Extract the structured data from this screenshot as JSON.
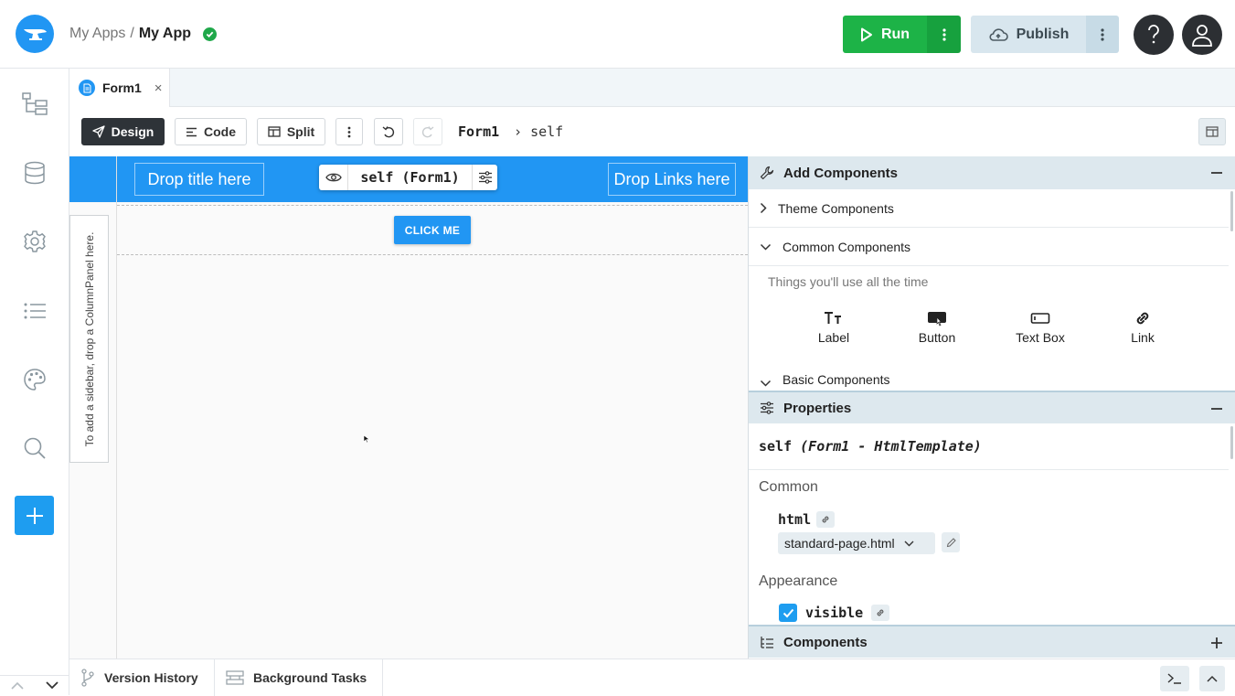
{
  "header": {
    "breadcrumb_root": "My Apps",
    "breadcrumb_sep": "/",
    "app_name": "My App",
    "run_label": "Run",
    "publish_label": "Publish"
  },
  "tabs": [
    {
      "label": "Form1",
      "close": "×"
    }
  ],
  "toolbar": {
    "design_label": "Design",
    "code_label": "Code",
    "split_label": "Split",
    "breadcrumb_form": "Form1",
    "breadcrumb_self": "self"
  },
  "canvas": {
    "drop_title": "Drop title here",
    "drop_links": "Drop Links here",
    "selected_component": "self (Form1)",
    "sidebar_hint": "To add a sidebar, drop a ColumnPanel here.",
    "button_text": "CLICK ME"
  },
  "add_components": {
    "title": "Add Components",
    "sections": [
      "Theme Components",
      "Common Components",
      "Basic Components"
    ],
    "common_description": "Things you'll use all the time",
    "items": [
      {
        "label": "Label",
        "icon": "label-icon"
      },
      {
        "label": "Button",
        "icon": "button-icon"
      },
      {
        "label": "Text Box",
        "icon": "textbox-icon"
      },
      {
        "label": "Link",
        "icon": "link-icon"
      }
    ]
  },
  "properties": {
    "title": "Properties",
    "object_name": "self",
    "object_type": "(Form1 - HtmlTemplate)",
    "groups": [
      "Common",
      "Appearance"
    ],
    "html_label": "html",
    "html_value": "standard-page.html",
    "visible_label": "visible",
    "visible_checked": true
  },
  "components_panel": {
    "title": "Components"
  },
  "bottom": {
    "version_history": "Version History",
    "background_tasks": "Background Tasks"
  },
  "colors": {
    "accent": "#2196f3",
    "run_green": "#1db347",
    "dark": "#2e3338"
  }
}
